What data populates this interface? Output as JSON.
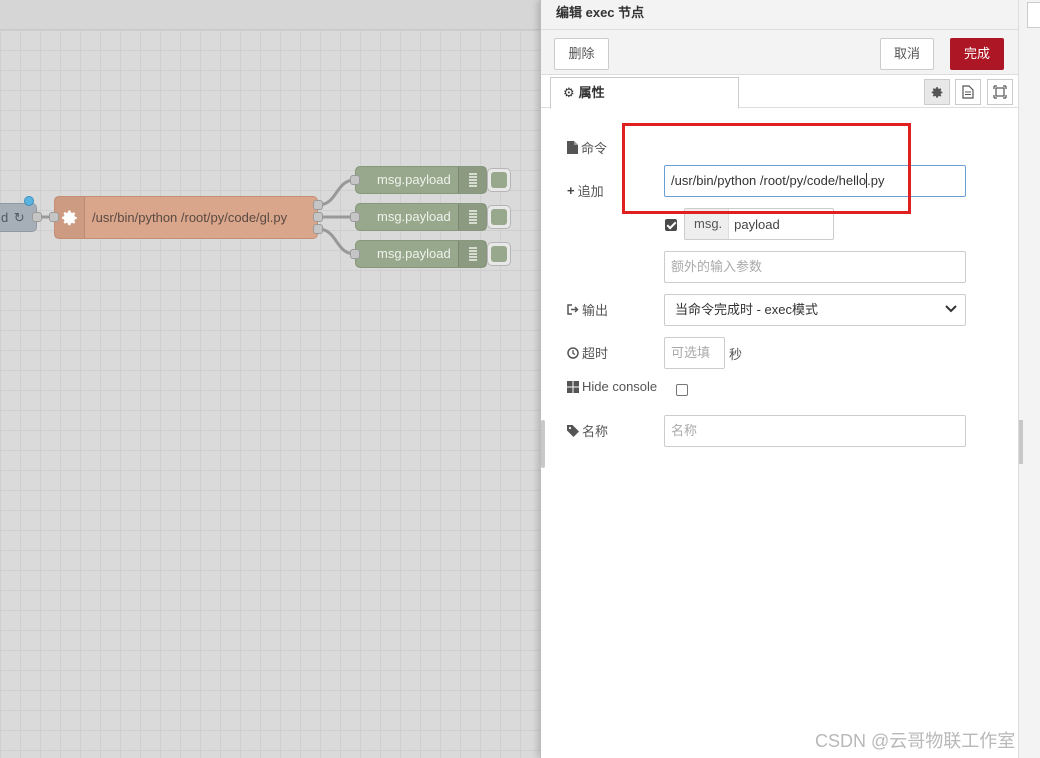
{
  "canvas": {
    "inject_label": "d",
    "inject_icon": "refresh-icon",
    "exec_node_label": "/usr/bin/python /root/py/code/gl.py",
    "exec_node_icon": "gear-icon",
    "debug_nodes": [
      {
        "label": "msg.payload"
      },
      {
        "label": "msg.payload"
      },
      {
        "label": "msg.payload"
      }
    ]
  },
  "tray": {
    "title": "编辑 exec 节点",
    "buttons": {
      "delete": "删除",
      "cancel": "取消",
      "done": "完成"
    },
    "tab": {
      "label": "属性",
      "icon": "gear-icon"
    },
    "tab_icons": [
      "gear-icon",
      "document-icon",
      "frame-icon"
    ]
  },
  "form": {
    "command": {
      "label": "命令",
      "icon": "file-icon",
      "value_before_cursor": "/usr/bin/python /root/py/code/hello",
      "value_after_cursor": ".py"
    },
    "append": {
      "label": "追加",
      "icon": "plus-icon",
      "checked": true,
      "prefix": "msg.",
      "value": "payload",
      "extra_placeholder": "额外的输入参数"
    },
    "output": {
      "label": "输出",
      "icon": "sign-out-icon",
      "selected": "当命令完成时 - exec模式"
    },
    "timeout": {
      "label": "超时",
      "icon": "clock-icon",
      "placeholder": "可选填",
      "unit": "秒"
    },
    "hide_console": {
      "label": "Hide console",
      "icon": "windows-icon",
      "checked": false
    },
    "name": {
      "label": "名称",
      "icon": "tag-icon",
      "placeholder": "名称"
    }
  },
  "watermark": "CSDN @云哥物联工作室",
  "colors": {
    "done_button": "#ad1625",
    "exec_node": "#d9a58b",
    "debug_node": "#98a88c",
    "highlight_box": "#e02020"
  }
}
